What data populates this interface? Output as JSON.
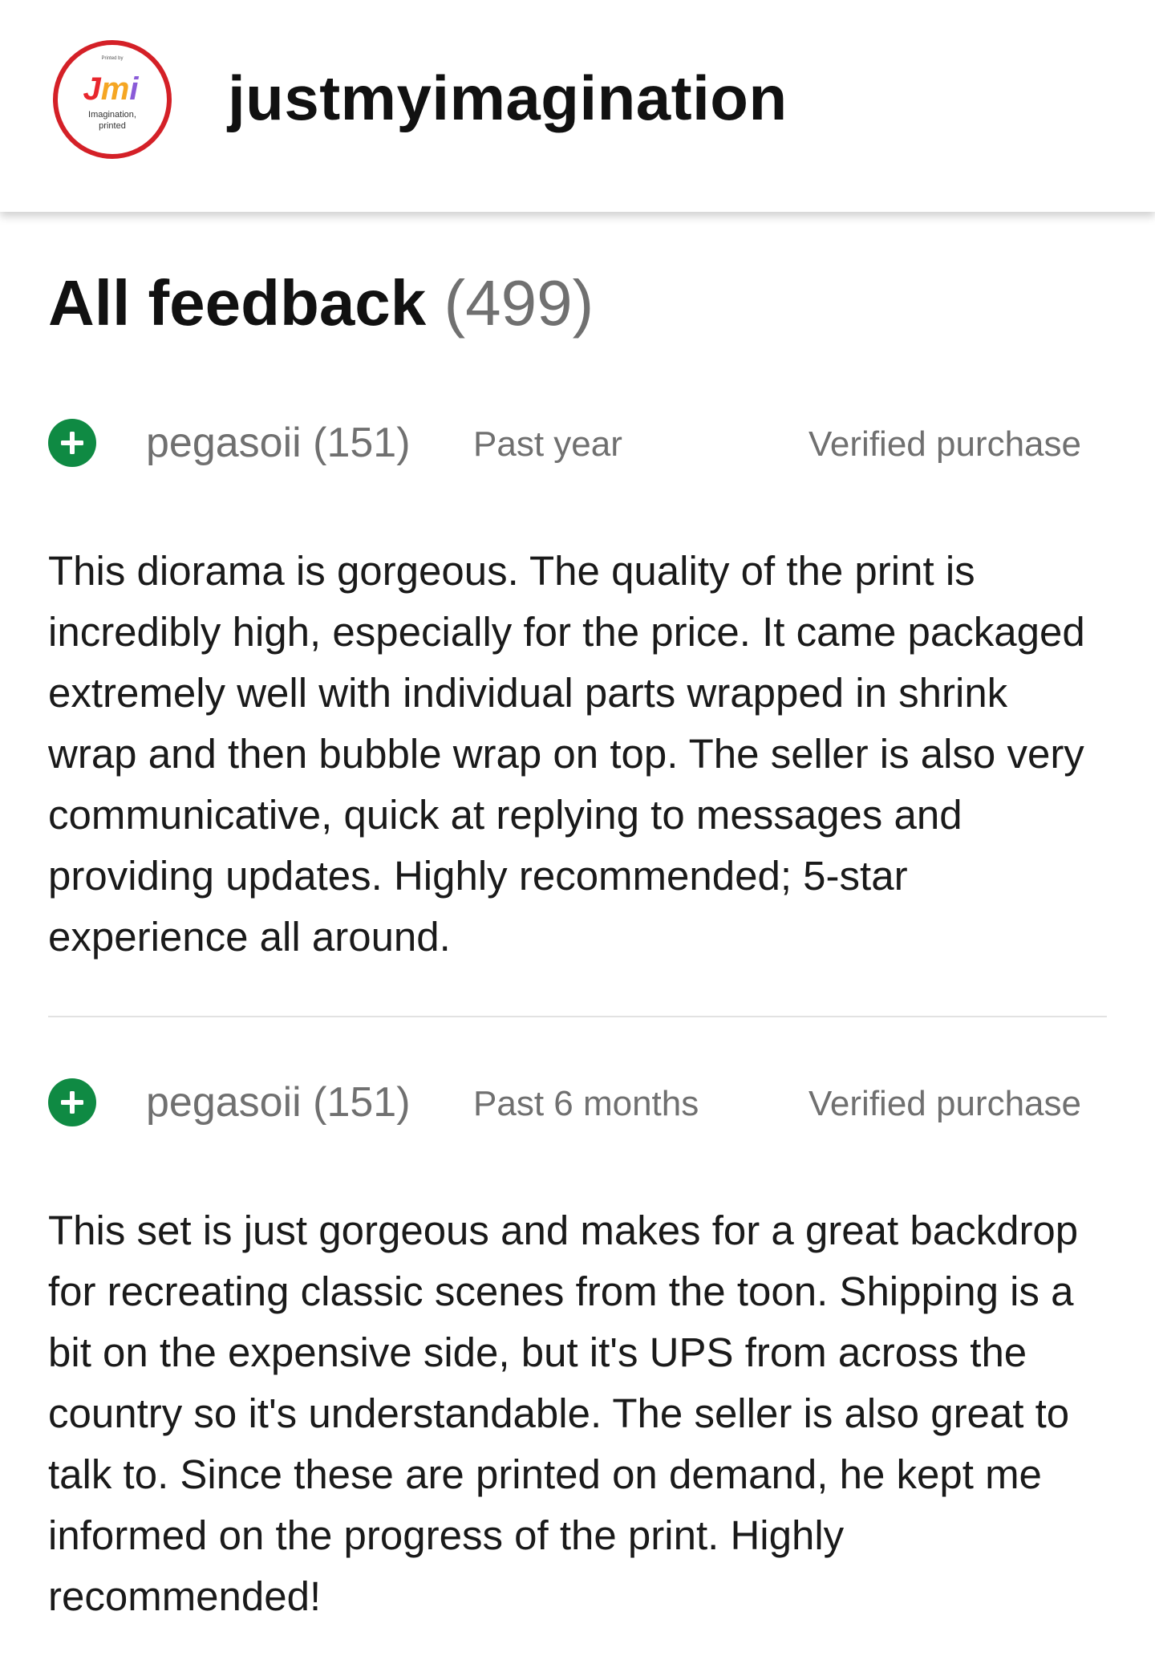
{
  "header": {
    "store_name": "justmyimagination",
    "logo": {
      "top_text": "Printed by",
      "monogram": "Jmi",
      "tagline_1": "Imagination,",
      "tagline_2": "printed",
      "colors": {
        "ring": "#d42027",
        "j": "#e8262d",
        "m": "#f5a623",
        "i": "#8a5bd8"
      }
    }
  },
  "page": {
    "title": "All feedback",
    "count": "(499)"
  },
  "colors": {
    "positive_badge": "#0f8a43",
    "secondary_text": "#707070",
    "divider": "#e2e2e2"
  },
  "reviews": [
    {
      "rating_icon": "plus-icon",
      "reviewer": "pegasoii (151)",
      "period": "Past year",
      "verified": "Verified purchase",
      "text": "This diorama is gorgeous. The quality of the print is incredibly high, especially for the price. It came packaged extremely well with individual parts wrapped in shrink wrap and then bubble wrap on top. The seller is also very communicative, quick at replying to messages and providing updates. Highly recommended; 5-star experience all around."
    },
    {
      "rating_icon": "plus-icon",
      "reviewer": "pegasoii (151)",
      "period": "Past 6 months",
      "verified": "Verified purchase",
      "text": "This set is just gorgeous and makes for a great backdrop for recreating classic scenes from the toon. Shipping is a bit on the expensive side, but it's UPS from across the country so it's understandable. The seller is also great to talk to. Since these are printed on demand, he kept me informed on the progress of the print. Highly recommended!"
    }
  ]
}
